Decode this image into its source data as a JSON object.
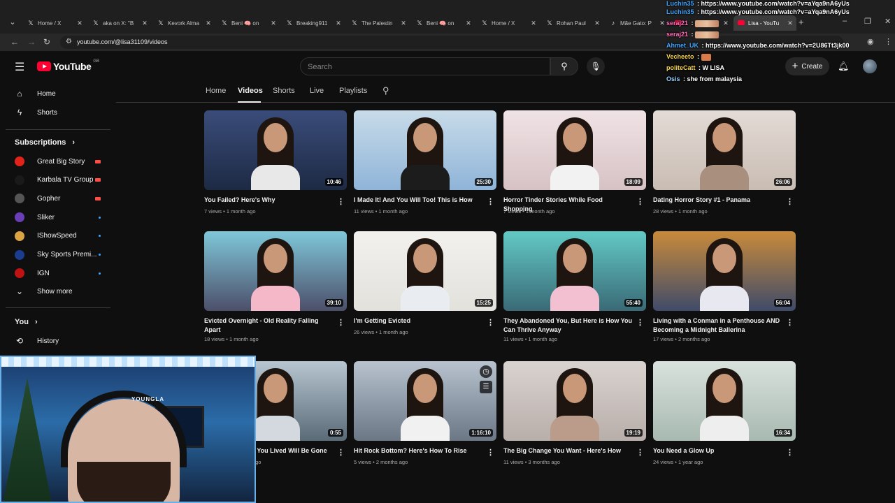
{
  "browser": {
    "tabs": [
      {
        "title": "Home / X",
        "icon": "x-logo-icon"
      },
      {
        "title": "aka on X: \"B",
        "icon": "x-logo-icon"
      },
      {
        "title": "Kevork Alma",
        "icon": "x-logo-icon"
      },
      {
        "title": "Beni 🧠 on",
        "icon": "x-logo-icon"
      },
      {
        "title": "Breaking911",
        "icon": "x-logo-icon"
      },
      {
        "title": "The Palestin",
        "icon": "x-logo-icon"
      },
      {
        "title": "Beni 🧠 on",
        "icon": "x-logo-icon"
      },
      {
        "title": "Home / X",
        "icon": "x-logo-icon"
      },
      {
        "title": "Rohan Paul",
        "icon": "x-logo-icon"
      },
      {
        "title": "Mãe Gato: P",
        "icon": "tiktok-icon"
      },
      {
        "title": "",
        "icon": "youtube-icon"
      },
      {
        "title": "Lisa - YouTu",
        "icon": "youtube-icon",
        "active": true
      }
    ],
    "url": "youtube.com/@lisa31109/videos"
  },
  "youtube": {
    "logo_text": "YouTube",
    "region": "GB",
    "search_placeholder": "Search",
    "create_label": "Create"
  },
  "sidebar": {
    "main": [
      {
        "label": "Home",
        "icon": "home-icon"
      },
      {
        "label": "Shorts",
        "icon": "shorts-icon"
      }
    ],
    "subscriptions_title": "Subscriptions",
    "subscriptions": [
      {
        "name": "Great Big Story",
        "avatar_color": "#e2231a",
        "indicator": "live",
        "indicator_color": "#ff4e45"
      },
      {
        "name": "Karbala TV Group",
        "avatar_color": "#1a1a1a",
        "indicator": "live",
        "indicator_color": "#ff4e45"
      },
      {
        "name": "Gopher",
        "avatar_color": "#555555",
        "indicator": "live",
        "indicator_color": "#ff4e45"
      },
      {
        "name": "Sliker",
        "avatar_color": "#6a3fb5",
        "indicator": "new",
        "indicator_color": "#3ea6ff"
      },
      {
        "name": "IShowSpeed",
        "avatar_color": "#d9a441",
        "indicator": "new",
        "indicator_color": "#3ea6ff"
      },
      {
        "name": "Sky Sports Premi...",
        "avatar_color": "#1c3d8f",
        "indicator": "new",
        "indicator_color": "#3ea6ff"
      },
      {
        "name": "IGN",
        "avatar_color": "#bf1313",
        "indicator": "new",
        "indicator_color": "#3ea6ff"
      }
    ],
    "show_more": "Show more",
    "you_title": "You",
    "history": "History"
  },
  "channel_tabs": [
    "Home",
    "Videos",
    "Shorts",
    "Live",
    "Playlists"
  ],
  "active_channel_tab": "Videos",
  "videos": [
    {
      "title": "You Failed? Here's Why",
      "views": "7 views",
      "age": "1 month ago",
      "duration": "10:46",
      "bg": "#1d2a44",
      "top": "#3a4c7a",
      "shirt": "#e8e8e8"
    },
    {
      "title": "I Made It! And You Will Too! This is How",
      "views": "11 views",
      "age": "1 month ago",
      "duration": "25:30",
      "bg": "#8fb4d8",
      "top": "#c8dbe9",
      "shirt": "#1c1c1c"
    },
    {
      "title": "Horror Tinder Stories While Food Shopping",
      "views": "7 views",
      "age": "1 month ago",
      "duration": "18:09",
      "bg": "#d6c2c5",
      "top": "#f0e3e5",
      "shirt": "#f2f2f2"
    },
    {
      "title": "Dating Horror Story #1 - Panama",
      "views": "28 views",
      "age": "1 month ago",
      "duration": "26:06",
      "bg": "#c9bcb3",
      "top": "#e3dbd5",
      "shirt": "#a98f7e"
    },
    {
      "title": "Evicted Overnight - Old Reality Falling Apart",
      "views": "18 views",
      "age": "1 month ago",
      "duration": "39:10",
      "bg": "#4c4f6a",
      "top": "#7fc7d9",
      "shirt": "#f5b8c9"
    },
    {
      "title": "I'm Getting Evicted",
      "views": "26 views",
      "age": "1 month ago",
      "duration": "15:25",
      "bg": "#e3e1dc",
      "top": "#f2f1ee",
      "shirt": "#e9edf2"
    },
    {
      "title": "They Abandoned You, But Here is How You Can Thrive Anyway",
      "views": "11 views",
      "age": "1 month ago",
      "duration": "55:40",
      "bg": "#3a6a76",
      "top": "#62c9c5",
      "shirt": "#f2c0d0"
    },
    {
      "title": "Living with a Conman in a Penthouse AND Becoming a Midnight Ballerina",
      "views": "17 views",
      "age": "2 months ago",
      "duration": "56:04",
      "bg": "#3f4b6a",
      "top": "#c98a3a",
      "shirt": "#e8e8f0"
    },
    {
      "title": "In a Coma - What You Lived Will Be Gone",
      "views": "12 views",
      "age": "2 months ago",
      "duration": "0:55",
      "bg": "#5a6b78",
      "top": "#b7c6d0",
      "shirt": "#d3d9de"
    },
    {
      "title": "Hit Rock Bottom? Here's How To Rise",
      "views": "5 views",
      "age": "2 months ago",
      "duration": "1:16:10",
      "bg": "#6b7785",
      "top": "#b8c3cf",
      "shirt": "#f1f1f1"
    },
    {
      "title": "The Big Change You Want - Here's How",
      "views": "11 views",
      "age": "3 months ago",
      "duration": "19:19",
      "bg": "#b8aeaa",
      "top": "#d9d3cf",
      "shirt": "#bb9c8a"
    },
    {
      "title": "You Need a Glow Up",
      "views": "24 views",
      "age": "1 year ago",
      "duration": "16:34",
      "bg": "#a7b9b0",
      "top": "#d9e2dc",
      "shirt": "#eeeeee"
    }
  ],
  "chat": [
    {
      "user": "Luchin35",
      "user_color": "#3ea6ff",
      "text": "https://www.youtube.com/watch?v=aYqa9nA6yUs"
    },
    {
      "user": "Luchin35",
      "user_color": "#3ea6ff",
      "text": "https://www.youtube.com/watch?v=aYqa9nA6yUs"
    },
    {
      "user": "seraj21",
      "user_color": "#ff6bb5",
      "text": ""
    },
    {
      "user": "seraj21",
      "user_color": "#ff6bb5",
      "text": ""
    },
    {
      "user": "Ahmet_UK",
      "user_color": "#3ea6ff",
      "text": "https://www.youtube.com/watch?v=2U86Tt3jk00"
    },
    {
      "user": "Vecheeto",
      "user_color": "#f5d44a",
      "text": ""
    },
    {
      "user": "politeCatt",
      "user_color": "#f5d44a",
      "text": "W LISA"
    },
    {
      "user": "Osis",
      "user_color": "#9ad0ff",
      "text": "she from malaysia"
    }
  ],
  "webcam_brand": "YOUNGLA"
}
